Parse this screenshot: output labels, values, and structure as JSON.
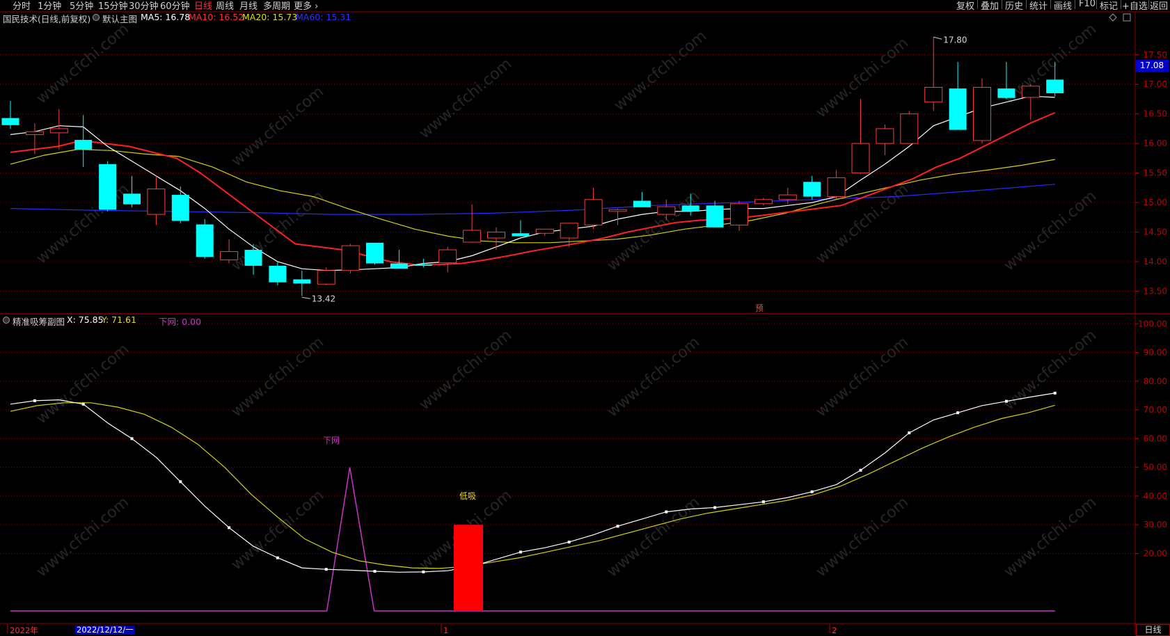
{
  "toolbar": {
    "periods": [
      "分时",
      "1分钟",
      "5分钟",
      "15分钟",
      "30分钟",
      "60分钟",
      "日线",
      "周线",
      "月线",
      "多周期",
      "更多 ›"
    ],
    "active_period": "日线",
    "right_tools": [
      "复权",
      "叠加",
      "历史",
      "统计",
      "画线",
      "F10",
      "标记",
      "+自选",
      "返回"
    ]
  },
  "main_header": {
    "stock": "国民技术(日线,前复权)",
    "template": "默认主图",
    "ma5": "MA5: 16.78",
    "ma10": "MA10: 16.52",
    "ma20": "MA20: 15.73",
    "ma60": "MA60: 15.31"
  },
  "sub_header": {
    "name": "精准吸筹副图",
    "x": "X: 75.85",
    "y": "Y: 71.61",
    "net": "下网: 0.00"
  },
  "current_price": "17.08",
  "date_cursor": "2022/12/12/一",
  "period_button": "日线",
  "colors": {
    "up": "#ff3b3b",
    "down": "#00ffff",
    "ma5": "#ffffff",
    "ma10": "#ff2020",
    "ma20": "#d4d400",
    "ma60": "#2a2aff",
    "net": "#cc33cc",
    "grid": "#8b0000",
    "bg": "#000000"
  },
  "chart_data": [
    {
      "type": "candlestick",
      "name": "main",
      "y_ticks": [
        13.5,
        14.0,
        14.5,
        15.0,
        15.5,
        16.0,
        16.5,
        17.0,
        17.5
      ],
      "ylim": [
        13.27,
        17.98
      ],
      "candles": [
        [
          16.43,
          16.72,
          16.25,
          16.31
        ],
        [
          16.15,
          16.34,
          15.82,
          16.2
        ],
        [
          16.18,
          16.58,
          15.9,
          16.25
        ],
        [
          16.06,
          16.48,
          15.6,
          15.9
        ],
        [
          15.65,
          15.7,
          14.85,
          14.88
        ],
        [
          15.15,
          15.45,
          14.92,
          14.97
        ],
        [
          14.8,
          15.45,
          14.62,
          15.23
        ],
        [
          15.13,
          15.27,
          14.65,
          14.69
        ],
        [
          14.63,
          14.72,
          14.05,
          14.08
        ],
        [
          14.03,
          14.38,
          13.97,
          14.17
        ],
        [
          14.2,
          14.3,
          13.78,
          13.93
        ],
        [
          13.93,
          14.0,
          13.6,
          13.65
        ],
        [
          13.7,
          13.85,
          13.42,
          13.63
        ],
        [
          13.62,
          13.9,
          13.6,
          13.85
        ],
        [
          13.85,
          14.3,
          13.8,
          14.27
        ],
        [
          14.32,
          14.32,
          13.95,
          13.97
        ],
        [
          13.97,
          14.2,
          13.9,
          13.88
        ],
        [
          13.95,
          14.05,
          13.9,
          13.93
        ],
        [
          13.98,
          14.25,
          13.82,
          14.2
        ],
        [
          14.33,
          14.97,
          14.32,
          14.53
        ],
        [
          14.4,
          14.58,
          14.2,
          14.5
        ],
        [
          14.48,
          14.7,
          14.46,
          14.43
        ],
        [
          14.48,
          14.55,
          14.44,
          14.55
        ],
        [
          14.4,
          14.65,
          14.25,
          14.65
        ],
        [
          14.62,
          15.25,
          14.55,
          15.05
        ],
        [
          14.85,
          14.9,
          14.62,
          14.88
        ],
        [
          15.03,
          15.18,
          14.92,
          14.92
        ],
        [
          14.8,
          15.05,
          14.7,
          14.93
        ],
        [
          14.95,
          15.15,
          14.78,
          14.85
        ],
        [
          14.95,
          15.03,
          14.58,
          14.58
        ],
        [
          14.62,
          15.03,
          14.52,
          14.98
        ],
        [
          14.98,
          15.08,
          14.95,
          15.05
        ],
        [
          15.05,
          15.25,
          14.98,
          15.13
        ],
        [
          15.35,
          15.45,
          15.05,
          15.1
        ],
        [
          15.1,
          15.55,
          15.05,
          15.42
        ],
        [
          15.5,
          16.75,
          15.48,
          16.0
        ],
        [
          16.0,
          16.32,
          15.8,
          16.25
        ],
        [
          16.0,
          16.55,
          16.0,
          16.5
        ],
        [
          16.7,
          17.8,
          16.55,
          16.95
        ],
        [
          16.93,
          17.38,
          16.25,
          16.23
        ],
        [
          16.05,
          17.1,
          16.0,
          16.95
        ],
        [
          16.93,
          17.38,
          16.75,
          16.77
        ],
        [
          16.78,
          17.0,
          16.4,
          16.97
        ],
        [
          17.08,
          17.38,
          16.8,
          16.85
        ]
      ],
      "ma5": [
        16.15,
        16.2,
        16.3,
        16.28,
        15.95,
        15.7,
        15.45,
        15.2,
        14.9,
        14.55,
        14.25,
        14.0,
        13.88,
        13.85,
        13.86,
        13.88,
        13.9,
        13.97,
        14.0,
        14.1,
        14.25,
        14.4,
        14.5,
        14.55,
        14.6,
        14.72,
        14.8,
        14.85,
        14.85,
        14.88,
        14.9,
        14.9,
        14.95,
        15.0,
        15.1,
        15.38,
        15.65,
        15.95,
        16.3,
        16.45,
        16.6,
        16.7,
        16.8,
        16.78
      ],
      "ma10": [
        15.85,
        15.9,
        15.95,
        16.05,
        16.0,
        15.95,
        15.85,
        15.75,
        15.5,
        15.2,
        14.9,
        14.6,
        14.3,
        14.25,
        14.2,
        14.1,
        14.0,
        13.95,
        13.95,
        13.97,
        14.03,
        14.1,
        14.18,
        14.25,
        14.32,
        14.4,
        14.5,
        14.58,
        14.66,
        14.7,
        14.72,
        14.75,
        14.8,
        14.85,
        14.9,
        14.95,
        15.1,
        15.25,
        15.4,
        15.6,
        15.75,
        15.95,
        16.15,
        16.35,
        16.52
      ],
      "ma20": [
        15.65,
        15.8,
        15.9,
        15.88,
        15.82,
        15.78,
        15.6,
        15.35,
        15.2,
        15.1,
        14.9,
        14.72,
        14.55,
        14.43,
        14.35,
        14.32,
        14.32,
        14.35,
        14.38,
        14.45,
        14.55,
        14.62,
        14.7,
        14.82,
        14.98,
        15.12,
        15.25,
        15.38,
        15.48,
        15.55,
        15.63,
        15.73
      ],
      "ma60": [
        14.9,
        14.87,
        14.85,
        14.83,
        14.8,
        14.8,
        14.82,
        14.87,
        14.95,
        15.0,
        15.05,
        15.1,
        15.2,
        15.31
      ],
      "markers": {
        "high": "17.80",
        "low": "13.42",
        "pre_label": "预"
      }
    },
    {
      "type": "line",
      "name": "精准吸筹副图",
      "y_ticks": [
        20,
        30,
        40,
        50,
        60,
        70,
        80,
        90,
        100
      ],
      "ylim": [
        0,
        102
      ],
      "series": [
        {
          "name": "X",
          "values": [
            72,
            73.2,
            73.5,
            72,
            65.5,
            60,
            53.5,
            45,
            36.5,
            29,
            22.5,
            18.5,
            15,
            14.5,
            14.2,
            13.8,
            13.5,
            13.6,
            14,
            15.5,
            18,
            20.5,
            22,
            24,
            26.5,
            29.5,
            32,
            34.5,
            35.5,
            36,
            37,
            38,
            39.5,
            41.5,
            44,
            49,
            55,
            62,
            66.5,
            69,
            71.5,
            73,
            74.5,
            75.85
          ]
        },
        {
          "name": "Y",
          "values": [
            69.5,
            71.5,
            72.5,
            72.5,
            71,
            68.5,
            64,
            58,
            50,
            40.5,
            32.5,
            25,
            20.5,
            17.5,
            16,
            15,
            14.8,
            15.5,
            17,
            18.5,
            20.5,
            22.5,
            24.5,
            27,
            29.5,
            32,
            34,
            35.5,
            37,
            38.5,
            40.5,
            43.5,
            47.5,
            52,
            56.5,
            60.5,
            64,
            67,
            69,
            71.61
          ]
        },
        {
          "name": "下网",
          "values": [
            0,
            0,
            0,
            0,
            0,
            0,
            0,
            0,
            0,
            0,
            0,
            0,
            0,
            0,
            50,
            0,
            0,
            0,
            0,
            0,
            0,
            0,
            0,
            0,
            0,
            0,
            0,
            0,
            0,
            0,
            0,
            0,
            0,
            0,
            0,
            0,
            0,
            0,
            0,
            0,
            0,
            0,
            0,
            0
          ]
        }
      ],
      "bar": {
        "label": "低吸",
        "value": 30
      },
      "net_label": "下网"
    }
  ],
  "x_axis": {
    "labels": [
      "2022年",
      "1",
      "2"
    ]
  }
}
